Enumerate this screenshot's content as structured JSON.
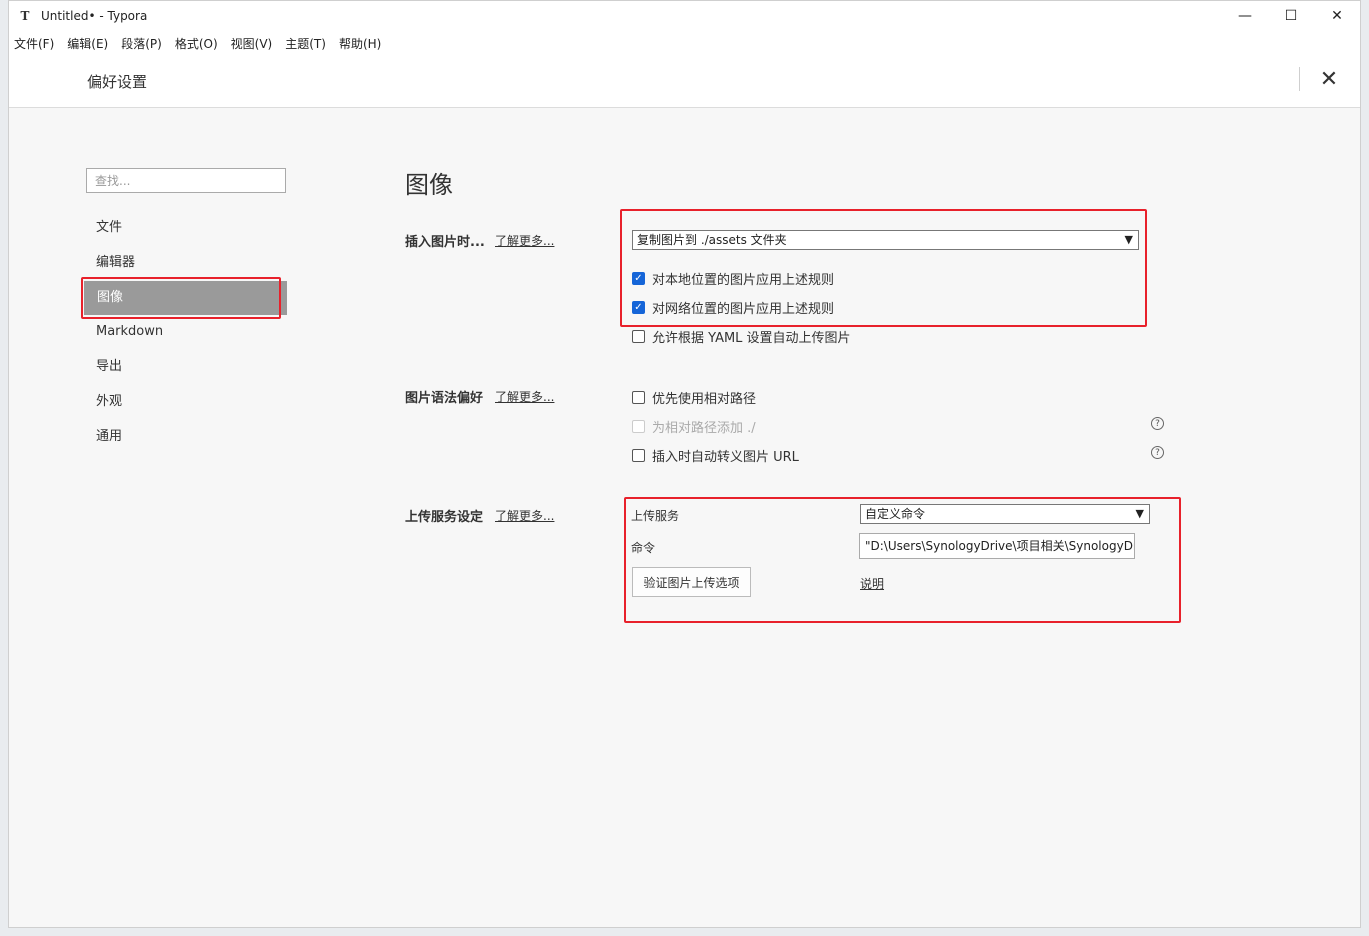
{
  "window": {
    "title": "Untitled• - Typora",
    "app_icon": "T",
    "controls": {
      "minimize": "—",
      "maximize": "☐",
      "close": "✕"
    }
  },
  "menubar": [
    "文件(F)",
    "编辑(E)",
    "段落(P)",
    "格式(O)",
    "视图(V)",
    "主题(T)",
    "帮助(H)"
  ],
  "prefs": {
    "title": "偏好设置",
    "close_glyph": "✕"
  },
  "sidebar": {
    "search_placeholder": "查找...",
    "items": [
      {
        "label": "文件",
        "active": false
      },
      {
        "label": "编辑器",
        "active": false
      },
      {
        "label": "图像",
        "active": true
      },
      {
        "label": "Markdown",
        "active": false
      },
      {
        "label": "导出",
        "active": false
      },
      {
        "label": "外观",
        "active": false
      },
      {
        "label": "通用",
        "active": false
      }
    ]
  },
  "content": {
    "section_title": "图像",
    "insert": {
      "label": "插入图片时...",
      "learn_more": "了解更多...",
      "action_selected": "复制图片到 ./assets 文件夹",
      "options": [
        {
          "label": "对本地位置的图片应用上述规则",
          "checked": true
        },
        {
          "label": "对网络位置的图片应用上述规则",
          "checked": true
        },
        {
          "label": "允许根据 YAML 设置自动上传图片",
          "checked": false
        }
      ]
    },
    "syntax": {
      "label": "图片语法偏好",
      "learn_more": "了解更多...",
      "options": [
        {
          "label": "优先使用相对路径",
          "checked": false,
          "disabled": false
        },
        {
          "label": "为相对路径添加 ./",
          "checked": false,
          "disabled": true
        },
        {
          "label": "插入时自动转义图片 URL",
          "checked": false,
          "disabled": false
        }
      ],
      "help_glyph": "?"
    },
    "upload": {
      "label": "上传服务设定",
      "learn_more": "了解更多...",
      "service_label": "上传服务",
      "service_selected": "自定义命令",
      "command_label": "命令",
      "command_value": "\"D:\\Users\\SynologyDrive\\项目相关\\SynologyDrive\\",
      "verify_button": "验证图片上传选项",
      "doc_link": "说明"
    }
  },
  "colors": {
    "highlight_box": "#e8212b",
    "active_nav": "#9a9a9a",
    "checkbox_checked": "#1565d8"
  }
}
